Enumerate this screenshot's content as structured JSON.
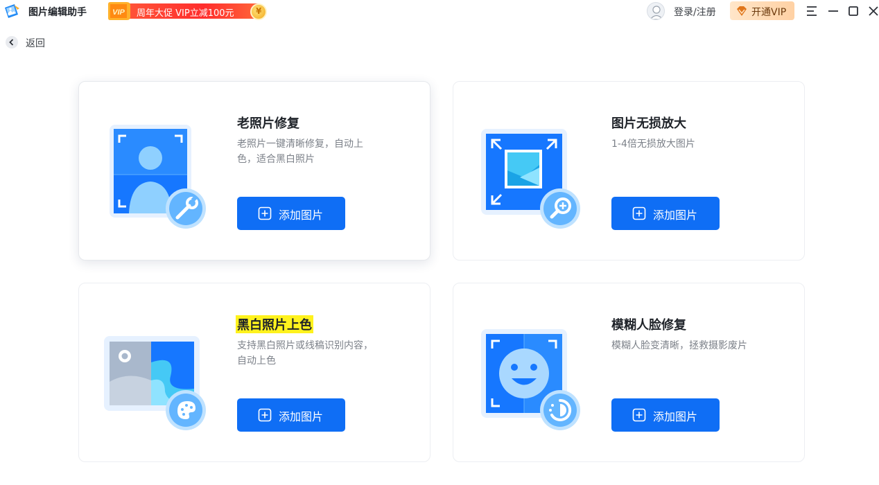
{
  "app": {
    "title": "图片编辑助手",
    "promo_text": "周年大促 VIP立减100元",
    "promo_tag": "VIP",
    "promo_coin": "¥"
  },
  "header": {
    "login_label": "登录/注册",
    "vip_label": "开通VIP",
    "icons": [
      "menu-icon",
      "minimize-icon",
      "maximize-icon",
      "close-icon"
    ]
  },
  "nav": {
    "back_label": "返回"
  },
  "cards": [
    {
      "title": "老照片修复",
      "desc": "老照片一键清晰修复，自动上色，适合黑白照片",
      "button": "添加图片",
      "icon": "old-photo-repair-illustration"
    },
    {
      "title": "图片无损放大",
      "desc": "1-4倍无损放大图片",
      "button": "添加图片",
      "icon": "image-upscale-illustration"
    },
    {
      "title": "黑白照片上色",
      "desc": "支持黑白照片或线稿识别内容，自动上色",
      "button": "添加图片",
      "icon": "colorize-illustration"
    },
    {
      "title": "模糊人脸修复",
      "desc": "模糊人脸变清晰，拯救摄影废片",
      "button": "添加图片",
      "icon": "face-restore-illustration"
    }
  ],
  "colors": {
    "primary": "#0f6ef5",
    "highlight": "#fff21d",
    "promo": "#ff2d2d",
    "vip_bg": "#ffd1a4"
  }
}
